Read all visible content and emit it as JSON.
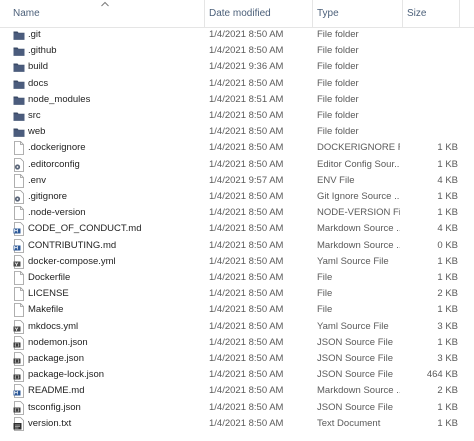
{
  "header": {
    "name": "Name",
    "date_modified": "Date modified",
    "type": "Type",
    "size": "Size"
  },
  "files": [
    {
      "name": ".git",
      "date": "1/4/2021 8:50 AM",
      "type": "File folder",
      "size": "",
      "icon": "folder-icon"
    },
    {
      "name": ".github",
      "date": "1/4/2021 8:50 AM",
      "type": "File folder",
      "size": "",
      "icon": "folder-icon"
    },
    {
      "name": "build",
      "date": "1/4/2021 9:36 AM",
      "type": "File folder",
      "size": "",
      "icon": "folder-icon"
    },
    {
      "name": "docs",
      "date": "1/4/2021 8:50 AM",
      "type": "File folder",
      "size": "",
      "icon": "folder-icon"
    },
    {
      "name": "node_modules",
      "date": "1/4/2021 8:51 AM",
      "type": "File folder",
      "size": "",
      "icon": "folder-icon"
    },
    {
      "name": "src",
      "date": "1/4/2021 8:50 AM",
      "type": "File folder",
      "size": "",
      "icon": "folder-icon"
    },
    {
      "name": "web",
      "date": "1/4/2021 8:50 AM",
      "type": "File folder",
      "size": "",
      "icon": "folder-icon"
    },
    {
      "name": ".dockerignore",
      "date": "1/4/2021 8:50 AM",
      "type": "DOCKERIGNORE F...",
      "size": "1 KB",
      "icon": "file-icon"
    },
    {
      "name": ".editorconfig",
      "date": "1/4/2021 8:50 AM",
      "type": "Editor Config Sour...",
      "size": "1 KB",
      "icon": "settings-file-icon"
    },
    {
      "name": ".env",
      "date": "1/4/2021 9:57 AM",
      "type": "ENV File",
      "size": "4 KB",
      "icon": "file-icon"
    },
    {
      "name": ".gitignore",
      "date": "1/4/2021 8:50 AM",
      "type": "Git Ignore Source ...",
      "size": "1 KB",
      "icon": "settings-file-icon"
    },
    {
      "name": ".node-version",
      "date": "1/4/2021 8:50 AM",
      "type": "NODE-VERSION Fi...",
      "size": "1 KB",
      "icon": "file-icon"
    },
    {
      "name": "CODE_OF_CONDUCT.md",
      "date": "1/4/2021 8:50 AM",
      "type": "Markdown Source ...",
      "size": "4 KB",
      "icon": "markdown-file-icon"
    },
    {
      "name": "CONTRIBUTING.md",
      "date": "1/4/2021 8:50 AM",
      "type": "Markdown Source ...",
      "size": "0 KB",
      "icon": "markdown-file-icon"
    },
    {
      "name": "docker-compose.yml",
      "date": "1/4/2021 8:50 AM",
      "type": "Yaml Source File",
      "size": "1 KB",
      "icon": "yaml-file-icon"
    },
    {
      "name": "Dockerfile",
      "date": "1/4/2021 8:50 AM",
      "type": "File",
      "size": "1 KB",
      "icon": "file-icon"
    },
    {
      "name": "LICENSE",
      "date": "1/4/2021 8:50 AM",
      "type": "File",
      "size": "2 KB",
      "icon": "file-icon"
    },
    {
      "name": "Makefile",
      "date": "1/4/2021 8:50 AM",
      "type": "File",
      "size": "1 KB",
      "icon": "file-icon"
    },
    {
      "name": "mkdocs.yml",
      "date": "1/4/2021 8:50 AM",
      "type": "Yaml Source File",
      "size": "3 KB",
      "icon": "yaml-file-icon"
    },
    {
      "name": "nodemon.json",
      "date": "1/4/2021 8:50 AM",
      "type": "JSON Source File",
      "size": "1 KB",
      "icon": "json-file-icon"
    },
    {
      "name": "package.json",
      "date": "1/4/2021 8:50 AM",
      "type": "JSON Source File",
      "size": "3 KB",
      "icon": "json-file-icon"
    },
    {
      "name": "package-lock.json",
      "date": "1/4/2021 8:50 AM",
      "type": "JSON Source File",
      "size": "464 KB",
      "icon": "json-file-icon"
    },
    {
      "name": "README.md",
      "date": "1/4/2021 8:50 AM",
      "type": "Markdown Source ...",
      "size": "2 KB",
      "icon": "markdown-file-icon"
    },
    {
      "name": "tsconfig.json",
      "date": "1/4/2021 8:50 AM",
      "type": "JSON Source File",
      "size": "1 KB",
      "icon": "json-file-icon"
    },
    {
      "name": "version.txt",
      "date": "1/4/2021 8:50 AM",
      "type": "Text Document",
      "size": "1 KB",
      "icon": "text-file-icon"
    }
  ]
}
